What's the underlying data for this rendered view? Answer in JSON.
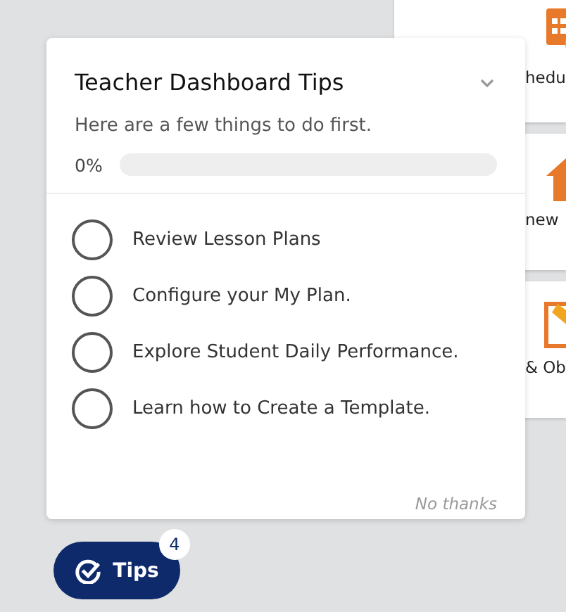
{
  "background_tiles": [
    {
      "kind": "schedule",
      "label": "hedu"
    },
    {
      "kind": "home",
      "label": "new"
    },
    {
      "kind": "pencil",
      "label": "& Ob"
    }
  ],
  "tips_panel": {
    "heading": "Teacher Dashboard Tips",
    "subtitle": "Here are a few things to do first.",
    "progress_text": "0%",
    "level": 0,
    "expanded": true,
    "items": [
      {
        "label": "Review Lesson Plans",
        "checked": false
      },
      {
        "label": "Configure your My Plan.",
        "checked": false
      },
      {
        "label": "Explore Student Daily Performance.",
        "checked": false
      },
      {
        "label": "Learn how to Create a Template.",
        "checked": false
      }
    ],
    "dismiss": "No thanks"
  },
  "tips_button": {
    "label": "Tips",
    "badge": "4"
  }
}
